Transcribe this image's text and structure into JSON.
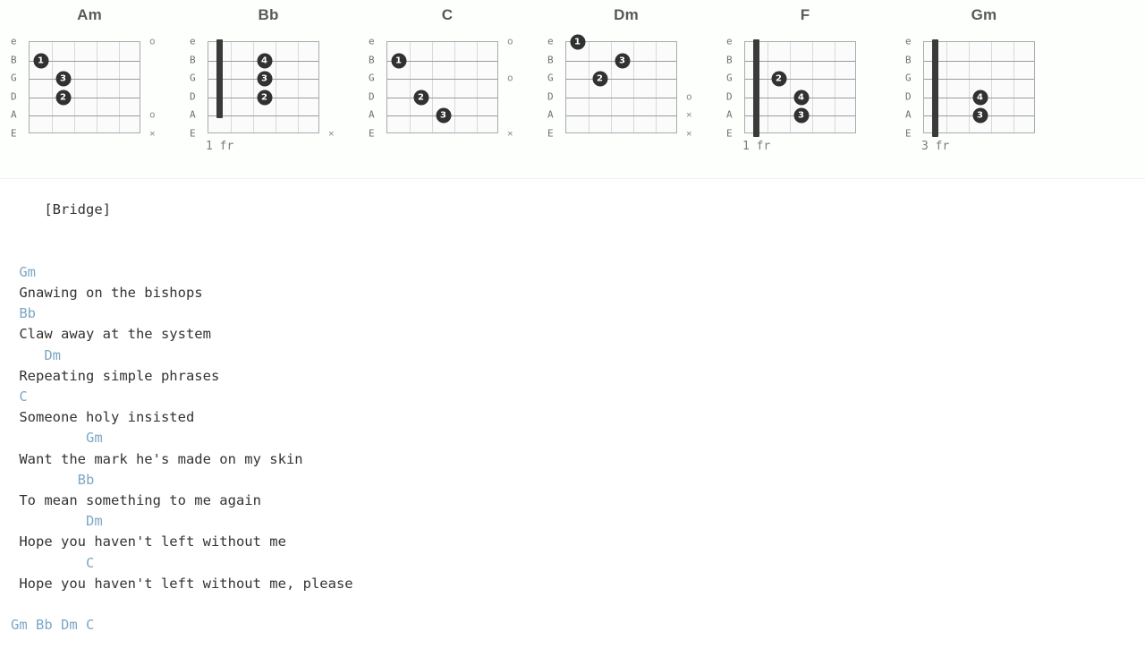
{
  "chords": [
    {
      "name": "Am",
      "frets": 5,
      "position_label": "",
      "barre": null,
      "dots": [
        {
          "string": 2,
          "fret": 1,
          "finger": "1"
        },
        {
          "string": 3,
          "fret": 2,
          "finger": "3"
        },
        {
          "string": 4,
          "fret": 2,
          "finger": "2"
        }
      ],
      "markers": [
        {
          "string": 1,
          "symbol": "o"
        },
        {
          "string": 5,
          "symbol": "o"
        },
        {
          "string": 6,
          "symbol": "×"
        }
      ]
    },
    {
      "name": "Bb",
      "frets": 5,
      "position_label": "1 fr",
      "barre": {
        "fret": 1,
        "from_string": 1,
        "to_string": 5
      },
      "dots": [
        {
          "string": 2,
          "fret": 3,
          "finger": "4"
        },
        {
          "string": 3,
          "fret": 3,
          "finger": "3"
        },
        {
          "string": 4,
          "fret": 3,
          "finger": "2"
        }
      ],
      "markers": [
        {
          "string": 6,
          "symbol": "×"
        }
      ]
    },
    {
      "name": "C",
      "frets": 5,
      "position_label": "",
      "barre": null,
      "dots": [
        {
          "string": 2,
          "fret": 1,
          "finger": "1"
        },
        {
          "string": 4,
          "fret": 2,
          "finger": "2"
        },
        {
          "string": 5,
          "fret": 3,
          "finger": "3"
        }
      ],
      "markers": [
        {
          "string": 1,
          "symbol": "o"
        },
        {
          "string": 3,
          "symbol": "o"
        },
        {
          "string": 6,
          "symbol": "×"
        }
      ]
    },
    {
      "name": "Dm",
      "frets": 5,
      "position_label": "",
      "barre": null,
      "dots": [
        {
          "string": 1,
          "fret": 1,
          "finger": "1"
        },
        {
          "string": 2,
          "fret": 3,
          "finger": "3"
        },
        {
          "string": 3,
          "fret": 2,
          "finger": "2"
        }
      ],
      "markers": [
        {
          "string": 4,
          "symbol": "o"
        },
        {
          "string": 5,
          "symbol": "×"
        },
        {
          "string": 6,
          "symbol": "×"
        }
      ]
    },
    {
      "name": "F",
      "frets": 5,
      "position_label": "1 fr",
      "barre": {
        "fret": 1,
        "from_string": 1,
        "to_string": 6
      },
      "dots": [
        {
          "string": 3,
          "fret": 2,
          "finger": "2"
        },
        {
          "string": 4,
          "fret": 3,
          "finger": "4"
        },
        {
          "string": 5,
          "fret": 3,
          "finger": "3"
        }
      ],
      "markers": []
    },
    {
      "name": "Gm",
      "frets": 5,
      "position_label": "3 fr",
      "barre": {
        "fret": 1,
        "from_string": 1,
        "to_string": 6
      },
      "dots": [
        {
          "string": 4,
          "fret": 3,
          "finger": "4"
        },
        {
          "string": 5,
          "fret": 3,
          "finger": "3"
        }
      ],
      "markers": []
    }
  ],
  "string_labels": [
    "e",
    "B",
    "G",
    "D",
    "A",
    "E"
  ],
  "colors": {
    "chord_text": "#7da7c4",
    "lyric_text": "#333333",
    "chord_title": "#58595b",
    "grid_line": "#9a9c9e",
    "dot_fill": "#313131"
  },
  "sheet": {
    "section": "[Bridge]",
    "lines": [
      {
        "type": "blank",
        "text": ""
      },
      {
        "type": "chord",
        "text": " Gm"
      },
      {
        "type": "lyric",
        "text": " Gnawing on the bishops"
      },
      {
        "type": "chord",
        "text": " Bb"
      },
      {
        "type": "lyric",
        "text": " Claw away at the system"
      },
      {
        "type": "chord",
        "text": "    Dm"
      },
      {
        "type": "lyric",
        "text": " Repeating simple phrases"
      },
      {
        "type": "chord",
        "text": " C"
      },
      {
        "type": "lyric",
        "text": " Someone holy insisted"
      },
      {
        "type": "chord",
        "text": "         Gm"
      },
      {
        "type": "lyric",
        "text": " Want the mark he's made on my skin"
      },
      {
        "type": "chord",
        "text": "        Bb"
      },
      {
        "type": "lyric",
        "text": " To mean something to me again"
      },
      {
        "type": "chord",
        "text": "         Dm"
      },
      {
        "type": "lyric",
        "text": " Hope you haven't left without me"
      },
      {
        "type": "chord",
        "text": "         C"
      },
      {
        "type": "lyric",
        "text": " Hope you haven't left without me, please"
      },
      {
        "type": "blank",
        "text": ""
      },
      {
        "type": "chord",
        "text": "Gm Bb Dm C"
      }
    ]
  }
}
